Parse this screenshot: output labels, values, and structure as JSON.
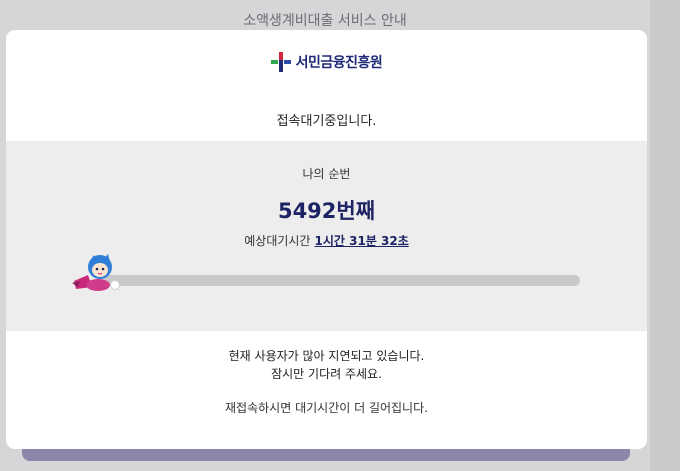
{
  "page": {
    "background_title": "소액생계비대출 서비스 안내"
  },
  "modal": {
    "logo_text": "서민금융진흥원",
    "status_text": "접속대기중입니다.",
    "queue_label": "나의 순번",
    "queue_number": "5492번째",
    "eta_label": "예상대기시간",
    "eta_value": "1시간 31분 32초",
    "progress": 0,
    "notice_line1": "현재 사용자가 많아 지연되고 있습니다.",
    "notice_line2": "잠시만 기다려 주세요.",
    "notice_line3": "재접속하시면 대기시간이 더 길어집니다."
  },
  "colors": {
    "brand_navy": "#1e2363",
    "panel_bg": "#ededee",
    "track": "#c9c9cb",
    "logo_red": "#d7263d",
    "logo_green": "#2ea84f",
    "logo_blue": "#2c4aa8"
  },
  "icons": {
    "logo_mark": "kinfa-logo-icon",
    "mascot": "flying-mascot-icon"
  }
}
